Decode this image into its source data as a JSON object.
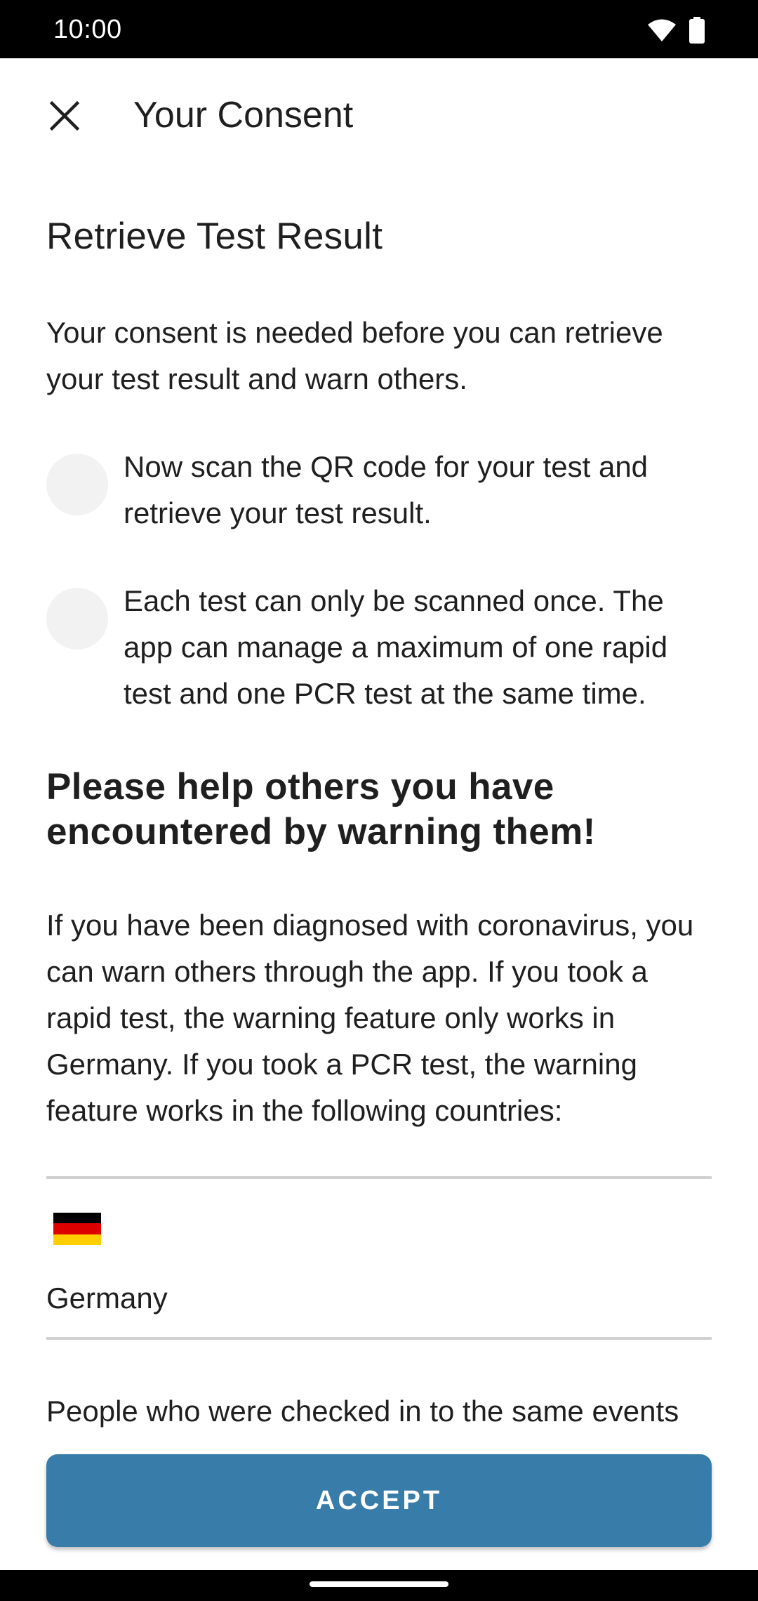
{
  "status_bar": {
    "time": "10:00",
    "icons": [
      "wifi-icon",
      "battery-icon"
    ]
  },
  "toolbar": {
    "close_icon": "close-icon",
    "title": "Your Consent"
  },
  "content": {
    "heading": "Retrieve Test Result",
    "intro": "Your consent is needed before you can retrieve your test result and warn others.",
    "bullets": [
      {
        "text": "Now scan the QR code for your test and retrieve your test result."
      },
      {
        "text": "Each test can only be scanned once. The app can manage a maximum of one rapid test and one PCR test at the same time."
      }
    ],
    "warn_heading": "Please help others you have encountered by warning them!",
    "warn_text": "If you have been diagnosed with coronavirus, you can warn others through the app. If you took a rapid test, the warning feature only works in Germany. If you took a PCR test, the warning feature works in the following countries:",
    "countries": [
      {
        "name": "Germany",
        "flag_colors": [
          "#000000",
          "#dd0000",
          "#ffce00"
        ]
      }
    ],
    "events_text": "People who were checked in to the same events"
  },
  "accept_button": {
    "label": "ACCEPT",
    "color": "#387ca9"
  }
}
